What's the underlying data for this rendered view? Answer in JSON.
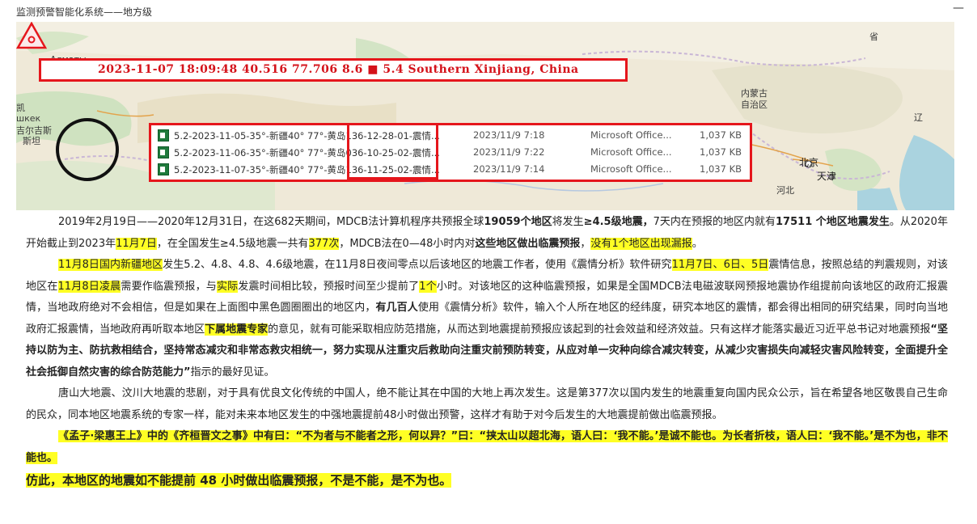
{
  "window": {
    "title": "监测预警智能化系统——地方级",
    "minimize": "—"
  },
  "map": {
    "quake_line": "2023-11-07 18:09:48 40.516 77.706 8.6 ■ 5.4 Southern Xinjiang, China",
    "labels": {
      "almaty": "Алматы",
      "kai": "凯",
      "shkek": "шкек",
      "kyrgyz": "吉尔吉斯",
      "kyrgyz2": "斯坦",
      "inner_mongolia_1": "内蒙古",
      "inner_mongolia_2": "自治区",
      "beijing": "北京",
      "tianjin": "天津",
      "hebei": "河北",
      "sheng": "省",
      "liao": "辽",
      "l1": "一",
      "l2": "~"
    },
    "marker_icon": "warning-triangle-icon",
    "files": [
      {
        "name": "5.2-2023-11-05-35°-新疆40°  77°-黄岛136-12-28-01-震情...",
        "date": "2023/11/9 7:18",
        "type": "Microsoft Office...",
        "size": "1,037 KB"
      },
      {
        "name": "5.2-2023-11-06-35°-新疆40°  77°-黄岛036-10-25-02-震情...",
        "date": "2023/11/9 7:22",
        "type": "Microsoft Office...",
        "size": "1,037 KB"
      },
      {
        "name": "5.2-2023-11-07-35°-新疆40°  77°-黄岛136-11-25-02-震情...",
        "date": "2023/11/9 7:14",
        "type": "Microsoft Office...",
        "size": "1,037 KB"
      }
    ]
  },
  "article": {
    "p1": {
      "a": "2019年2月19日——2020年12月31日，在这682天期间，MDCB法计算机程序共预报全球",
      "b": "19059个地区",
      "c": "将发生",
      "d": "≥4.5级地震，",
      "e": "7天内在预报的地区内就有",
      "f": "17511 个地区地震发生",
      "g": "。从2020年开始截止到2023年",
      "h": "11月7日",
      "i": "，在全国发生≥4.5级地震一共有",
      "j": "377次",
      "k": "，MDCB法在0—48小时内对",
      "l": "这些地区做出临震预报",
      "m": "，",
      "n": "没有1个地区出现漏报",
      "o": "。"
    },
    "p2": {
      "a": "11月8日国内新疆地区",
      "b": "发生5.2、4.8、4.8、4.6级地震，在11月8日夜间零点以后该地区的地震工作者，使用《震情分析》软件研究",
      "c": "11月7日、6日、5日",
      "d": "震情信息，按照总结的判震规则，对该地区在",
      "e": "11月8日凌晨",
      "f": "需要作临震预报，与",
      "g": "实际",
      "h": "发震时间相比较，预报时间至少提前了",
      "i": "1个",
      "j": "小时。对该地区的这种临震预报，如果是全国MDCB法电磁波联网预报地震协作组提前向该地区的政府汇报震情，当地政府绝对不会相信，但是如果在上面图中黑色圆圈圈出的地区内，",
      "k": "有几百人",
      "l": "使用《震情分析》软件，输入个人所在地区的经纬度，研究本地区的震情，都会得出相同的研究结果，同时向当地政府汇报震情，当地政府再听取本地区",
      "m": "下属地震专家",
      "n": "的意见，就有可能采取相应防范措施，从而达到地震提前预报应该起到的社会效益和经济效益。只有这样才能落实最近习近平总书记对地震预报",
      "o": "“坚持以防为主、防抗救相结合，坚持常态减灾和非常态救灾相统一，努力实现从注重灾后救助向注重灾前预防转变，从应对单一灾种向综合减灾转变，从减少灾害损失向减轻灾害风险转变，全面提升全社会抵御自然灾害的综合防范能力”",
      "p": "指示的最好见证。"
    },
    "p3": "唐山大地震、汶川大地震的悲剧，对于具有优良文化传统的中国人，绝不能让其在中国的大地上再次发生。这是第377次以国内发生的地震重复向国内民众公示，旨在希望各地区敬畏自己生命的民众，同本地区地震系统的专家一样，能对未来本地区发生的中强地震提前48小时做出预警，这样才有助于对今后发生的大地震提前做出临震预报。",
    "p4": "《孟子·梁惠王上》中的《齐桓晋文之事》中有曰：“不为者与不能者之形，何以异？”曰：“挟太山以超北海，语人曰：‘我不能。’是诚不能也。为长者折枝，语人曰：‘我不能。’是不为也，非不能也。",
    "p5": "仿此，本地区的地震如不能提前 48 小时做出临震预报，不是不能，是不为也。"
  }
}
